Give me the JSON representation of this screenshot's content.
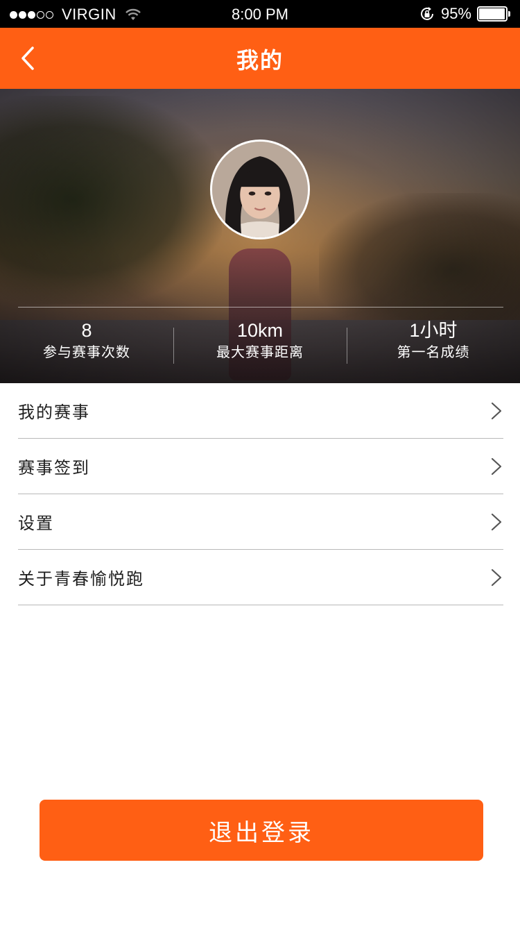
{
  "status_bar": {
    "carrier": "VIRGIN",
    "time": "8:00 PM",
    "battery": "95%",
    "signal_icon": "signal-dots-icon",
    "wifi_icon": "wifi-icon",
    "lock_icon": "rotation-lock-icon",
    "battery_icon": "battery-icon"
  },
  "nav": {
    "title": "我的",
    "back_icon": "chevron-left-icon"
  },
  "profile": {
    "avatar_icon": "avatar"
  },
  "stats": [
    {
      "value": "8",
      "label": "参与赛事次数"
    },
    {
      "value": "10km",
      "label": "最大赛事距离"
    },
    {
      "value": "1小时",
      "label": "第一名成绩"
    }
  ],
  "menu": [
    {
      "label": "我的赛事"
    },
    {
      "label": "赛事签到"
    },
    {
      "label": "设置"
    },
    {
      "label": "关于青春愉悦跑"
    }
  ],
  "logout_label": "退出登录",
  "colors": {
    "accent": "#ff5f14",
    "status_bar": "#000000",
    "divider": "#b8b8b8"
  }
}
